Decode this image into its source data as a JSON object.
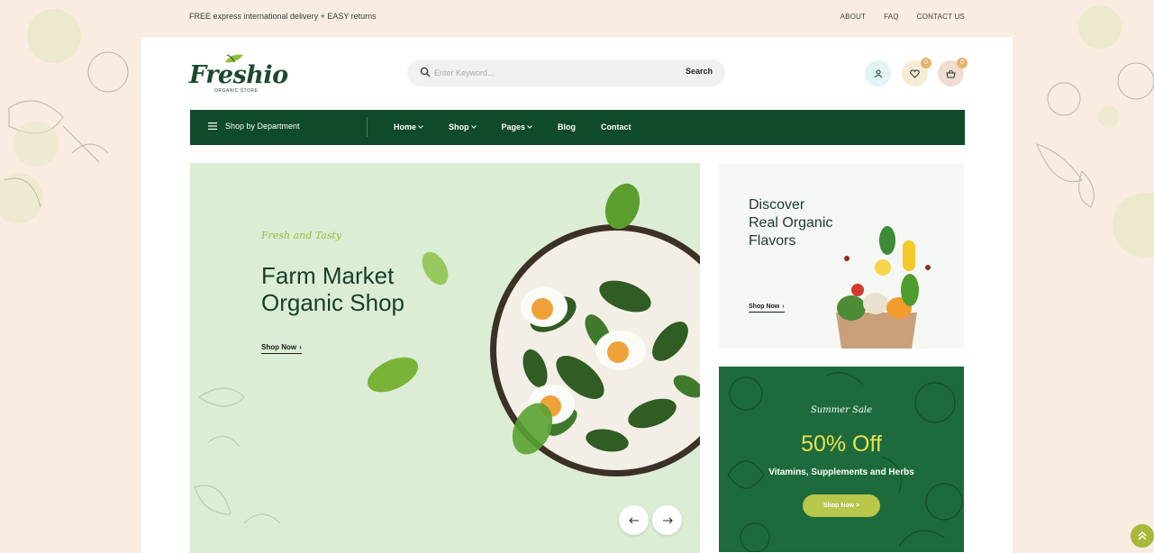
{
  "topbar": {
    "promo": "FREE express international delivery + EASY returns",
    "links": [
      "ABOUT",
      "FAQ",
      "CONTACT US"
    ]
  },
  "logo": {
    "name": "Freshio",
    "tagline": "ORGANIC STORE"
  },
  "search": {
    "placeholder": "Enter Keyword...",
    "button": "Search"
  },
  "header_icons": {
    "wishlist_count": "0",
    "cart_count": "0"
  },
  "nav": {
    "department": "Shop by Department",
    "items": [
      {
        "label": "Home"
      },
      {
        "label": "Shop"
      },
      {
        "label": "Pages"
      },
      {
        "label": "Blog"
      },
      {
        "label": "Contact"
      }
    ]
  },
  "hero": {
    "script": "Fresh and Tasty",
    "title_line1": "Farm Market",
    "title_line2": "Organic Shop",
    "cta": "Shop Now"
  },
  "promo_card": {
    "title_line1": "Discover",
    "title_line2": "Real Organic",
    "title_line3": "Flavors",
    "cta": "Shop Now"
  },
  "sale_card": {
    "script": "Summer Sale",
    "headline": "50% Off",
    "subtitle": "Vitamins, Supplements and Herbs",
    "cta": "Shop Now >"
  },
  "colors": {
    "brand_green": "#0f4a2b",
    "sale_green": "#1d6b3c",
    "accent_yellow": "#e9e04a",
    "accent_lime": "#b8c64a"
  }
}
